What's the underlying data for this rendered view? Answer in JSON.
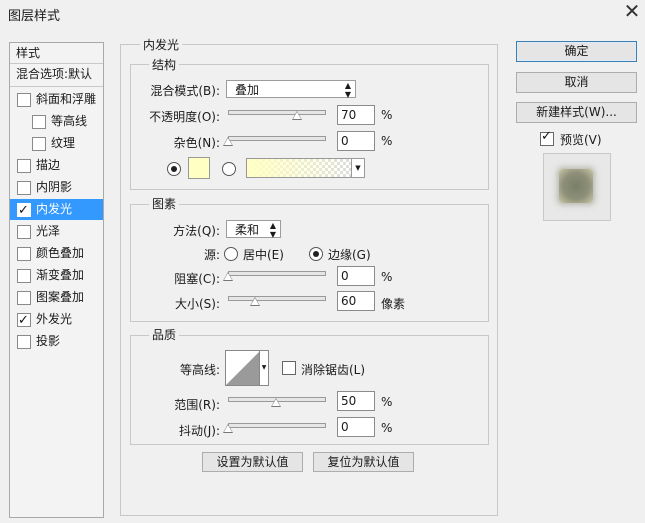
{
  "window": {
    "title": "图层样式",
    "close_symbol": "✕"
  },
  "style_list": {
    "header": "样式",
    "blend_options": "混合选项:默认",
    "items": [
      {
        "label": "斜面和浮雕",
        "checked": false,
        "indent": false,
        "selected": false
      },
      {
        "label": "等高线",
        "checked": false,
        "indent": true,
        "selected": false
      },
      {
        "label": "纹理",
        "checked": false,
        "indent": true,
        "selected": false
      },
      {
        "label": "描边",
        "checked": false,
        "indent": false,
        "selected": false
      },
      {
        "label": "内阴影",
        "checked": false,
        "indent": false,
        "selected": false
      },
      {
        "label": "内发光",
        "checked": true,
        "indent": false,
        "selected": true
      },
      {
        "label": "光泽",
        "checked": false,
        "indent": false,
        "selected": false
      },
      {
        "label": "颜色叠加",
        "checked": false,
        "indent": false,
        "selected": false
      },
      {
        "label": "渐变叠加",
        "checked": false,
        "indent": false,
        "selected": false
      },
      {
        "label": "图案叠加",
        "checked": false,
        "indent": false,
        "selected": false
      },
      {
        "label": "外发光",
        "checked": true,
        "indent": false,
        "selected": false
      },
      {
        "label": "投影",
        "checked": false,
        "indent": false,
        "selected": false
      }
    ]
  },
  "panel": {
    "title": "内发光",
    "structure": {
      "title": "结构",
      "blend_mode_label": "混合模式(B):",
      "blend_mode_value": "叠加",
      "opacity_label": "不透明度(O):",
      "opacity_value": "70",
      "opacity_unit": "%",
      "noise_label": "杂色(N):",
      "noise_value": "0",
      "noise_unit": "%",
      "glow_color": "#ffffc4"
    },
    "elements": {
      "title": "图素",
      "technique_label": "方法(Q):",
      "technique_value": "柔和",
      "source_label": "源:",
      "source_center": "居中(E)",
      "source_edge": "边缘(G)",
      "choke_label": "阻塞(C):",
      "choke_value": "0",
      "choke_unit": "%",
      "size_label": "大小(S):",
      "size_value": "60",
      "size_unit": "像素"
    },
    "quality": {
      "title": "品质",
      "contour_label": "等高线:",
      "antialias_label": "消除锯齿(L)",
      "range_label": "范围(R):",
      "range_value": "50",
      "range_unit": "%",
      "jitter_label": "抖动(J):",
      "jitter_value": "0",
      "jitter_unit": "%"
    },
    "make_default": "设置为默认值",
    "reset_default": "复位为默认值"
  },
  "side": {
    "ok": "确定",
    "cancel": "取消",
    "new_style": "新建样式(W)...",
    "preview_label": "预览(V)",
    "preview_checked": true
  }
}
